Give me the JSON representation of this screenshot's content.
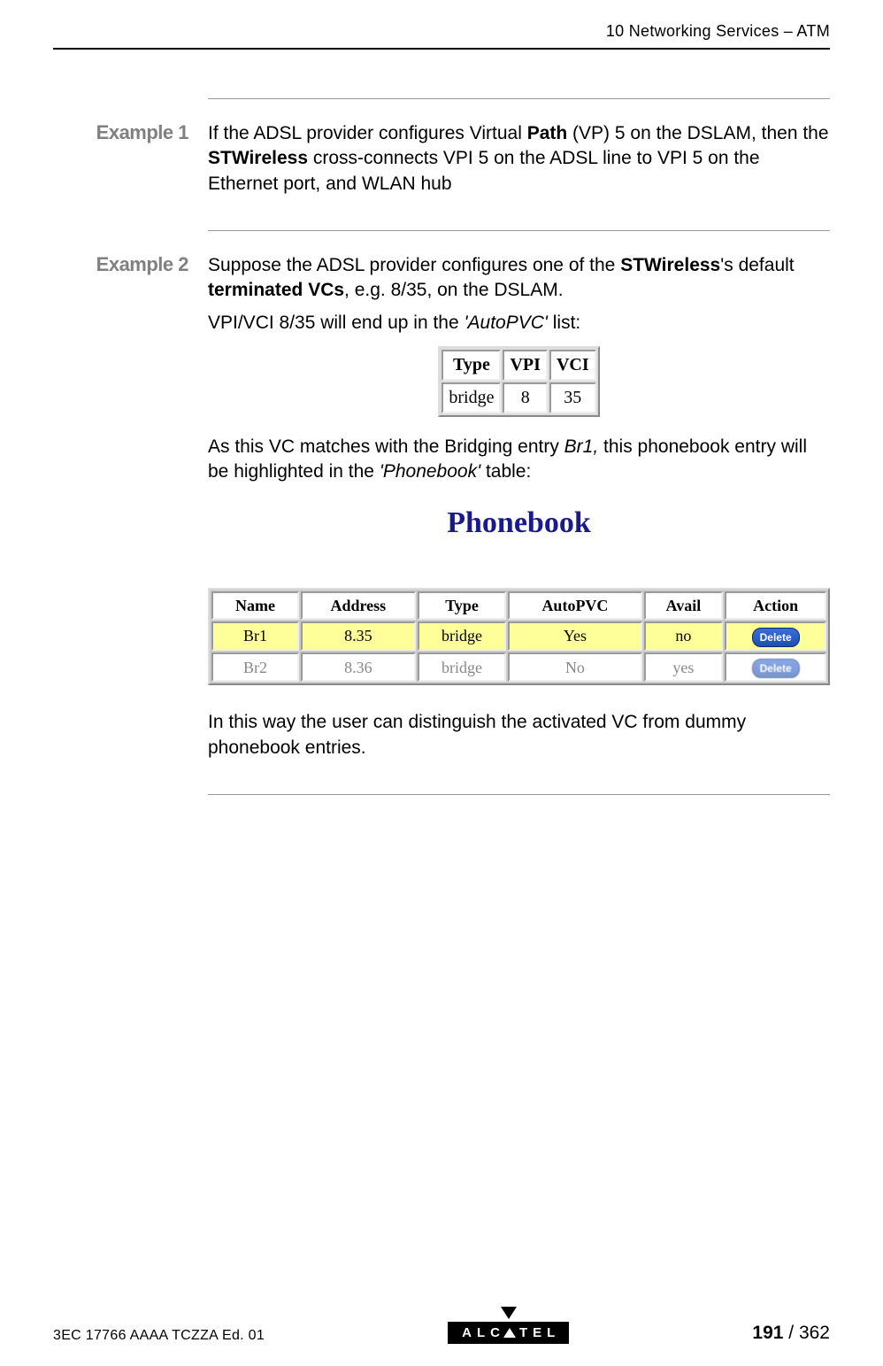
{
  "header": {
    "chapter": "10 Networking Services – ATM"
  },
  "example1": {
    "label": "Example 1",
    "text_pre": "If the ADSL provider configures Virtual ",
    "b1": "Path",
    "text_mid1": " (VP) 5 on the DSLAM, then the ",
    "b2": "STWireless",
    "text_post": " cross-connects VPI 5 on the ADSL line to VPI 5 on the Ethernet port, and WLAN hub"
  },
  "example2": {
    "label": "Example 2",
    "p1_pre": "Suppose the ADSL provider configures one of the ",
    "p1_b1": "STWireless",
    "p1_mid": "'s default ",
    "p1_b2": "terminated VCs",
    "p1_post": ", e.g. 8/35, on the DSLAM.",
    "p2_pre": "VPI/VCI 8/35 will end up in the ",
    "p2_i": "'AutoPVC'",
    "p2_post": " list:",
    "autopvc": {
      "headers": [
        "Type",
        "VPI",
        "VCI"
      ],
      "row": [
        "bridge",
        "8",
        "35"
      ]
    },
    "p3_pre": "As this VC matches with the Bridging entry ",
    "p3_i1": "Br1,",
    "p3_mid": " this phonebook entry will be highlighted in the ",
    "p3_i2": "'Phonebook'",
    "p3_post": " table:",
    "phonebook_title": "Phonebook",
    "phonebook": {
      "headers": [
        "Name",
        "Address",
        "Type",
        "AutoPVC",
        "Avail",
        "Action"
      ],
      "rows": [
        {
          "name": "Br1",
          "address": "8.35",
          "type": "bridge",
          "autopvc": "Yes",
          "avail": "no",
          "action": "Delete",
          "highlight": true
        },
        {
          "name": "Br2",
          "address": "8.36",
          "type": "bridge",
          "autopvc": "No",
          "avail": "yes",
          "action": "Delete",
          "highlight": false
        }
      ]
    },
    "p4": "In this way the user can distinguish the activated VC from dummy phonebook entries."
  },
  "footer": {
    "doc_id": "3EC 17766 AAAA TCZZA Ed. 01",
    "logo_text_pre": "ALC",
    "logo_text_post": "TEL",
    "page_num": "191",
    "page_sep": " / ",
    "page_total": "362"
  }
}
